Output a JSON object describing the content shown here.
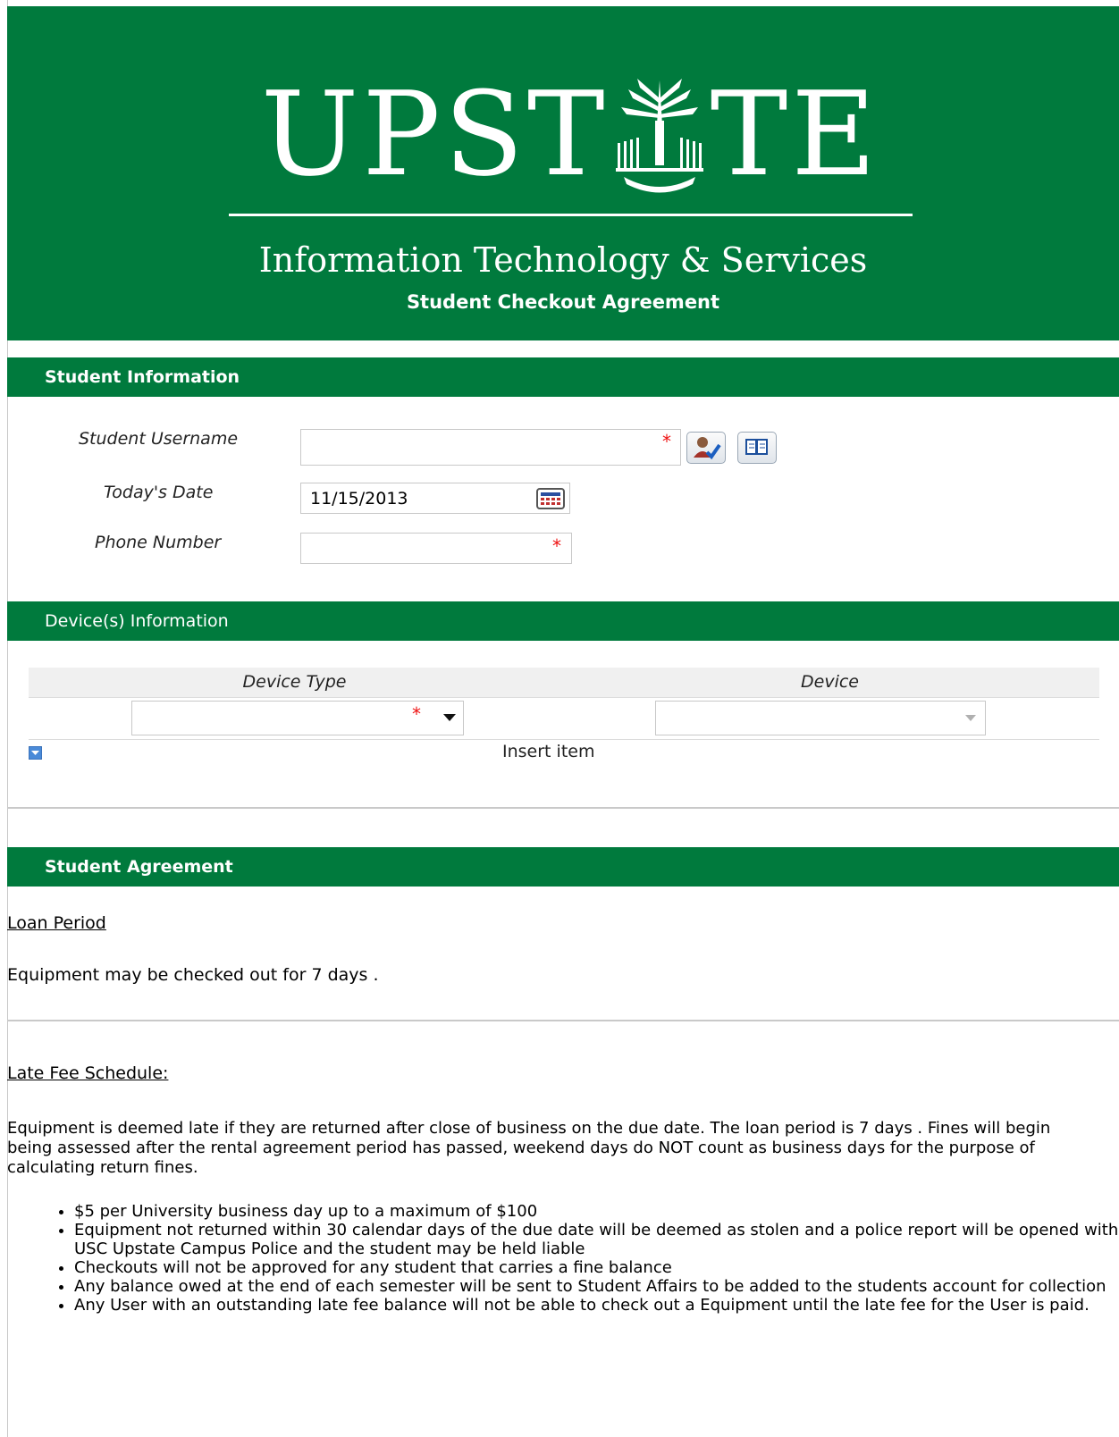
{
  "banner": {
    "logo_text_left": "UPST",
    "logo_text_right": "TE",
    "department": "Information Technology & Services",
    "title": "Student Checkout Agreement"
  },
  "student_section": {
    "heading": "Student Information",
    "username_label": "Student Username",
    "username_value": "",
    "date_label": "Today's Date",
    "date_value": "11/15/2013",
    "phone_label": "Phone Number",
    "phone_value": "",
    "required_mark": "*"
  },
  "device_section": {
    "heading": "Device(s) Information",
    "columns": [
      "Device Type",
      "Device"
    ],
    "device_type_value": "",
    "device_value": "",
    "insert_label": "Insert item"
  },
  "agreement_section": {
    "heading": "Student Agreement",
    "loan_period_title": "Loan Period",
    "loan_period_text": "Equipment may be checked out for  7 days .",
    "late_fee_title": "Late Fee Schedule:",
    "late_fee_text": "Equipment is deemed late if they are returned after close of business on the due date. The loan period is 7 days  . Fines will begin being assessed after the rental agreement period has passed, weekend days do NOT count as business days for the purpose of calculating return fines.",
    "fees": [
      "$5 per University business day up to a maximum of $100",
      "Equipment not returned within 30 calendar days of the due date will be deemed as stolen and a police report will be opened with USC Upstate Campus Police and the student may be held liable",
      "Checkouts will not be approved for any student that carries a fine balance",
      "Any balance owed at the end of each semester will be sent to Student Affairs to be added to the students account for collection",
      "Any User with an outstanding late fee balance will not be able to check out a Equipment until the late fee for the User is paid."
    ]
  },
  "colors": {
    "brand_green": "#007a3d",
    "required_red": "#e11111"
  }
}
